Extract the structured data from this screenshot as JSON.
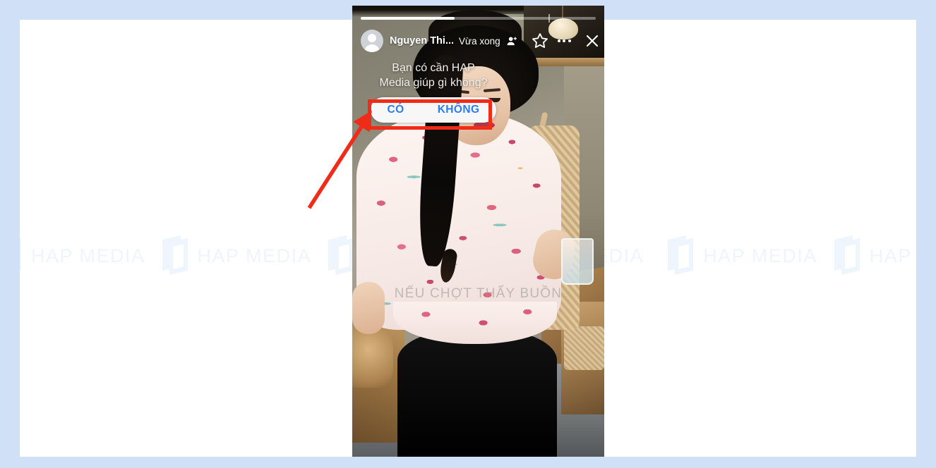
{
  "page": {
    "background_color": "#cfe0f7",
    "canvas_color": "#ffffff"
  },
  "watermark": {
    "text": "HAP MEDIA",
    "logo_icon": "hap-media-book-logo-icon",
    "color": "#eff5fc",
    "repeat_count": 6
  },
  "story": {
    "progress": {
      "fill_percent": 40,
      "divider_percent": 80
    },
    "header": {
      "avatar_icon": "default-user-avatar-icon",
      "username": "Nguyen Thi...",
      "timestamp": "Vừa xong",
      "close_friends_icon": "close-friends-person-icon",
      "favorite_icon": "star-icon",
      "more_icon": "more-options-dots-icon",
      "close_icon": "close-x-icon"
    },
    "question_sticker": {
      "question": "Bạn có cần HAP\nMedia giúp gì không?",
      "answers": [
        {
          "label": "CÓ"
        },
        {
          "label": "KHÔNG"
        }
      ],
      "answer_color": "#2a7ef0",
      "bar_color": "#f7f7f7"
    },
    "photo_caption": "NẾU CHỢT THẤY BUỒN"
  },
  "annotations": {
    "highlight_box": {
      "color": "#f02c18",
      "border_width": 5,
      "target": "answer-bar"
    },
    "arrow": {
      "color": "#f02c18",
      "points_to": "answer-bar-left-edge"
    }
  }
}
